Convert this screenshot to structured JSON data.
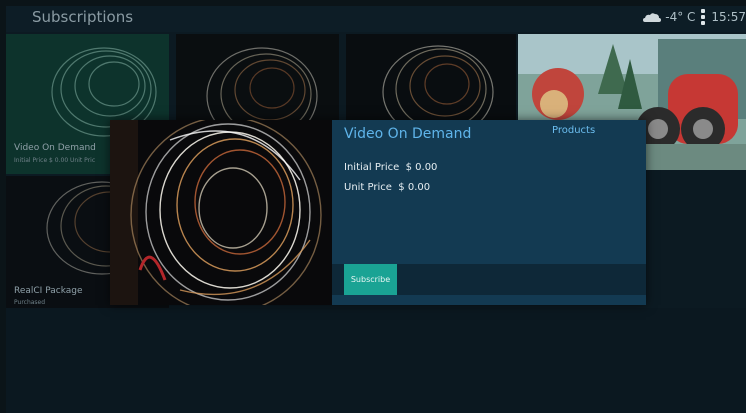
{
  "header": {
    "title": "Subscriptions",
    "weather_icon": "cloud-icon",
    "temperature": "-4° C",
    "menu_icon": "vertical-dots-icon",
    "clock": "15:57"
  },
  "tiles": [
    {
      "name": "Video On Demand",
      "detail": "Initial Price  $ 0.00  Unit Pric"
    },
    {
      "name": "RealCI Package",
      "detail": "Purchased"
    }
  ],
  "popup": {
    "title": "Video On Demand",
    "products_label": "Products",
    "initial_price_label": "Initial Price",
    "initial_price_value": "$ 0.00",
    "unit_price_label": "Unit Price",
    "unit_price_value": "$ 0.00",
    "subscribe_label": "Subscribe"
  },
  "colors": {
    "accent_teal": "#1aa394",
    "title_blue": "#5fb4ea",
    "panel": "#133a52"
  }
}
